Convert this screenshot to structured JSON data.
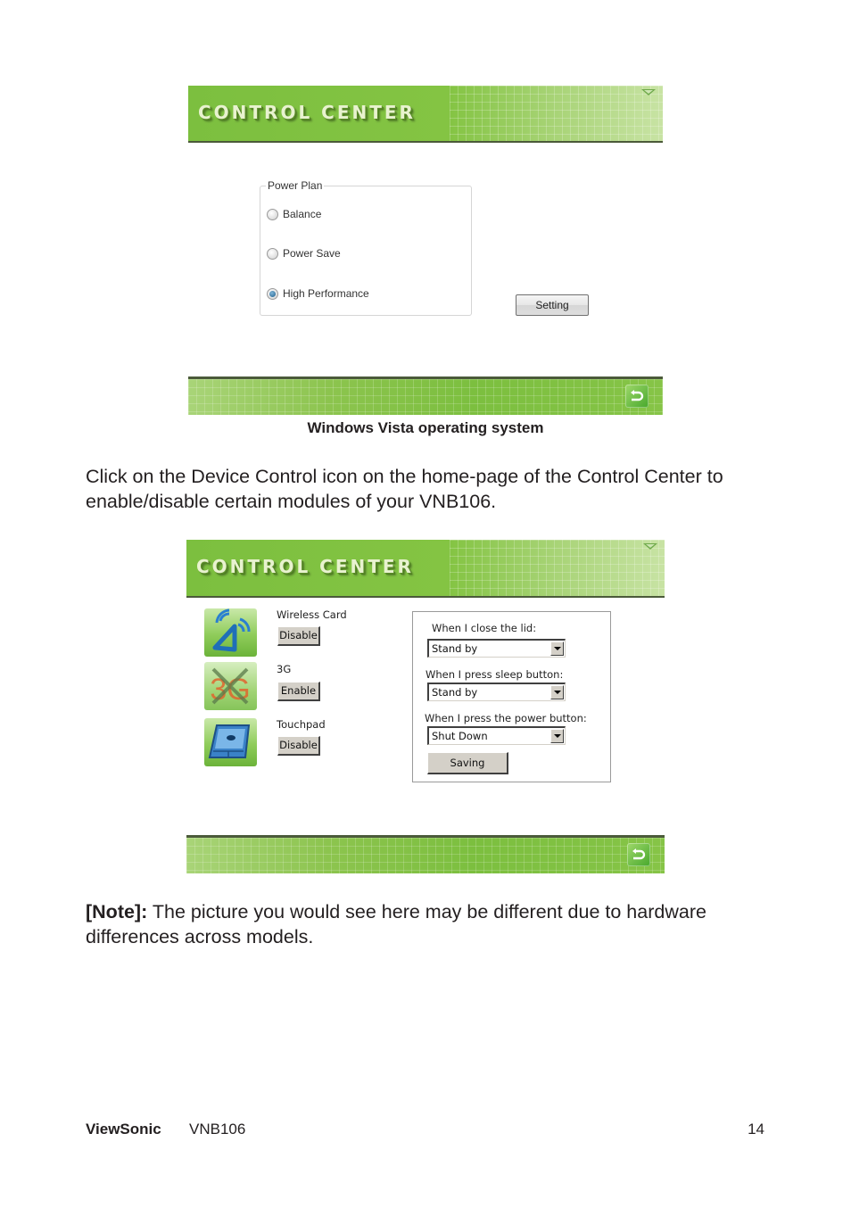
{
  "window1": {
    "title": "CONTROL CENTER",
    "power_plan": {
      "legend": "Power Plan",
      "options": [
        {
          "label": "Balance",
          "selected": false
        },
        {
          "label": "Power Save",
          "selected": false
        },
        {
          "label": "High Performance",
          "selected": true
        }
      ]
    },
    "setting_button": "Setting",
    "minimize_icon": "triangle-down-icon",
    "back_icon": "back-arrow-icon"
  },
  "caption": "Windows Vista operating system",
  "paragraph1": "Click on the Device Control icon on the home-page of the Control Center to enable/disable certain modules of your VNB106.",
  "window2": {
    "title": "CONTROL CENTER",
    "devices": [
      {
        "name": "Wireless Card",
        "button": "Disable",
        "icon": "wireless-card-icon"
      },
      {
        "name": "3G",
        "button": "Enable",
        "icon": "3g-disabled-icon"
      },
      {
        "name": "Touchpad",
        "button": "Disable",
        "icon": "touchpad-icon"
      }
    ],
    "power_settings": {
      "lid_label": "When I close the lid:",
      "lid_value": "Stand by",
      "sleep_label": "When I press sleep button:",
      "sleep_value": "Stand by",
      "power_label": "When I press the power button:",
      "power_value": "Shut Down",
      "save_button": "Saving"
    }
  },
  "note": {
    "label": "[Note]:",
    "text": " The picture you would see here may be different due to hardware differences across models."
  },
  "footer": {
    "brand": "ViewSonic",
    "model": "VNB106",
    "page": "14"
  }
}
